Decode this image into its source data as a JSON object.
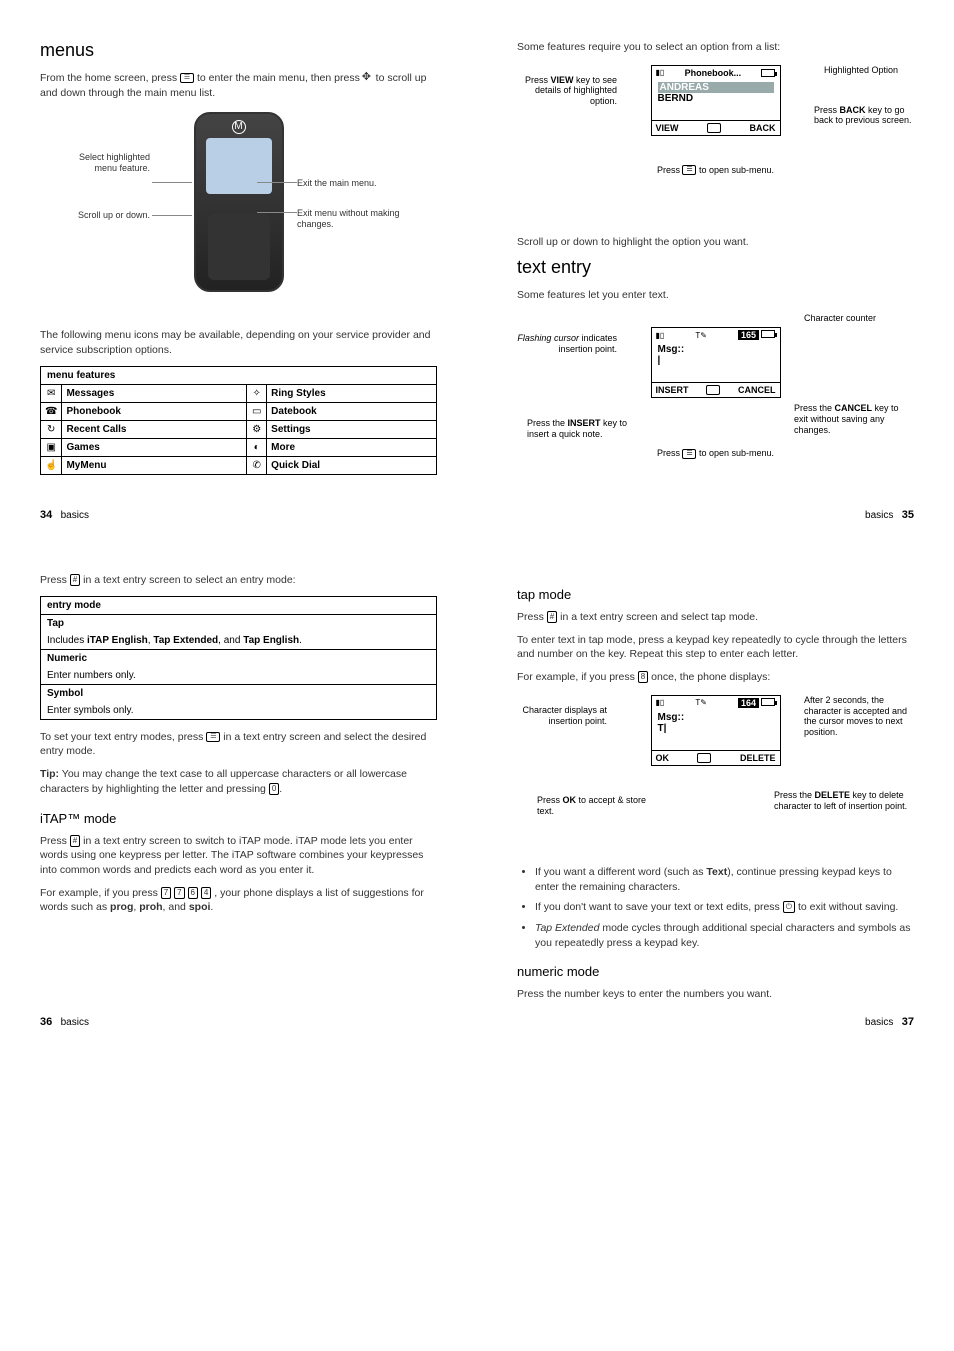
{
  "p34": {
    "title": "menus",
    "intro_a": "From the home screen, press ",
    "intro_b": " to enter the main menu, then press ",
    "intro_c": " to scroll up and down through the main menu list.",
    "callouts": {
      "select": "Select highlighted menu feature.",
      "scroll": "Scroll up or down.",
      "exit_main": "Exit the main menu.",
      "exit_nochange": "Exit menu without making changes."
    },
    "para2": "The following menu icons may be available, depending on your service provider and service subscription options.",
    "table_header": "menu features",
    "menu_left": [
      "Messages",
      "Phonebook",
      "Recent Calls",
      "Games",
      "MyMenu"
    ],
    "menu_right": [
      "Ring Styles",
      "Datebook",
      "Settings",
      "More",
      "Quick Dial"
    ],
    "footer_label": "basics",
    "pagenum": "34"
  },
  "p35": {
    "intro": "Some features require you to select an option from a list:",
    "screen": {
      "title": "Phonebook...",
      "items": [
        "ANDREAS",
        "BERND"
      ],
      "left_soft": "VIEW",
      "right_soft": "BACK"
    },
    "callouts": {
      "view": "Press the VIEW key to see details of highlighted option.",
      "highlighted": "Highlighted Option",
      "back": "Press the BACK key to go back to previous screen.",
      "open_sub": "Press   to open sub-menu."
    },
    "view_word": "VIEW",
    "back_word": "BACK",
    "press_word": "Press ",
    "open_sub_suffix": " to open sub-menu.",
    "scroll_hl": "Scroll up or down to highlight the option you want.",
    "h2": "text entry",
    "te_intro": "Some features let you enter text.",
    "screen2": {
      "counter": "165",
      "msg_label": "Msg::",
      "left_soft": "INSERT",
      "right_soft": "CANCEL"
    },
    "callouts2": {
      "char_counter": "Character counter",
      "flashing_a": "Flashing",
      "flashing_b": "cursor",
      "flashing_c": " indicates insertion point.",
      "insert_a": "Press the ",
      "insert_key": "INSERT",
      "insert_b": " key to insert a quick note.",
      "cancel_a": "Press the ",
      "cancel_key": "CANCEL",
      "cancel_b": " key to exit without saving any changes.",
      "open_sub2_a": "Press ",
      "open_sub2_b": " to open sub-menu."
    },
    "footer_label": "basics",
    "pagenum": "35"
  },
  "p36": {
    "intro_a": "Press ",
    "intro_b": " in a text entry screen to select an entry mode:",
    "table_header": "entry mode",
    "rows": {
      "tap_head": "Tap",
      "tap_body_a": "Includes ",
      "tap_body_b": "iTAP English",
      "tap_body_c": ", ",
      "tap_body_d": "Tap Extended",
      "tap_body_e": ", and ",
      "tap_body_f": "Tap English",
      "tap_body_g": ".",
      "num_head": "Numeric",
      "num_body": "Enter numbers only.",
      "sym_head": "Symbol",
      "sym_body": "Enter symbols only."
    },
    "set_mode_a": "To set your text entry modes, press ",
    "set_mode_b": " in a text entry screen and select the desired entry mode.",
    "tip_label": "Tip:",
    "tip_a": " You may change the text case to all uppercase characters or all lowercase characters by highlighting the letter and pressing ",
    "tip_b": ".",
    "h3": "iTAP™ mode",
    "itap_a": "Press ",
    "itap_b": " in a text entry screen to switch to iTAP mode. iTAP mode lets you enter words using one keypress per letter. The iTAP software combines your keypresses into common words and predicts each word as you enter it.",
    "example_a": "For example, if you press ",
    "example_b": " , your phone displays a list of suggestions for words such as ",
    "example_c": "prog",
    "example_d": ", ",
    "example_e": "proh",
    "example_f": ", and ",
    "example_g": "spoi",
    "example_h": ".",
    "keys": [
      "7",
      "7",
      "6",
      "4"
    ],
    "footer_label": "basics",
    "pagenum": "36"
  },
  "p37": {
    "h3": "tap mode",
    "tap_a": "Press ",
    "tap_b": " in a text entry screen and select tap mode.",
    "tap_para": "To enter text in tap mode, press a keypad key repeatedly to cycle through the letters and number on the key. Repeat this step to enter each letter.",
    "ex_a": "For example, if you press ",
    "ex_b": " once, the phone displays:",
    "ex_key": "8",
    "screen": {
      "counter": "164",
      "msg_label": "Msg::",
      "char": "T",
      "left_soft": "OK",
      "right_soft": "DELETE"
    },
    "callouts": {
      "char_disp": "Character displays at insertion point.",
      "after2": "After 2 seconds, the character is accepted and the cursor moves to next position.",
      "ok_a": "Press ",
      "ok_key": "OK",
      "ok_b": " to accept & store text.",
      "del_a": "Press the ",
      "del_key": "DELETE",
      "del_b": " key to delete character to left of insertion point."
    },
    "bullets": {
      "b1_a": "If you want a different word (such as ",
      "b1_b": "Text",
      "b1_c": "), continue pressing keypad keys to enter the remaining characters.",
      "b2_a": "If you don't want to save your text or text edits, press ",
      "b2_b": " to exit without saving.",
      "b3_a": "Tap Extended",
      "b3_b": " mode cycles through additional special characters and symbols as you repeatedly press a keypad key."
    },
    "h3b": "numeric mode",
    "num_para": "Press the number keys to enter the numbers you want.",
    "footer_label": "basics",
    "pagenum": "37"
  }
}
